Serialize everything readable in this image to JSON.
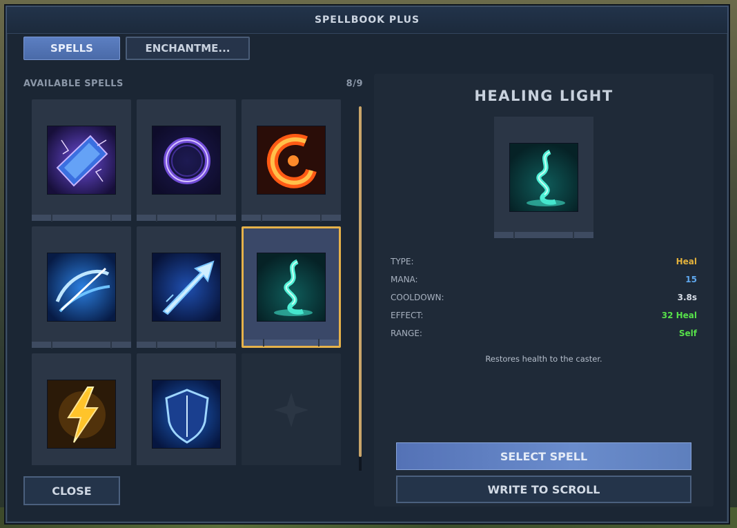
{
  "window": {
    "title": "SPELLBOOK PLUS"
  },
  "tabs": [
    {
      "label": "SPELLS",
      "active": true
    },
    {
      "label": "ENCHANTME...",
      "active": false
    }
  ],
  "spell_list": {
    "header": "AVAILABLE SPELLS",
    "count": "8/9",
    "scroll_fraction_visible": 0.96,
    "spells": [
      {
        "icon": "arcane-crystal-icon"
      },
      {
        "icon": "arcane-ring-icon"
      },
      {
        "icon": "fire-swirl-icon"
      },
      {
        "icon": "frost-slash-icon"
      },
      {
        "icon": "ice-arrow-icon"
      },
      {
        "icon": "healing-light-icon",
        "selected": true
      },
      {
        "icon": "lightning-bolt-icon"
      },
      {
        "icon": "frost-shield-icon"
      },
      {
        "icon": "empty-slot-icon",
        "empty": true
      }
    ]
  },
  "close_label": "CLOSE",
  "detail": {
    "name": "HEALING LIGHT",
    "icon": "healing-light-icon",
    "stats": [
      {
        "label": "TYPE:",
        "value": "Heal",
        "color": "#e3b23c"
      },
      {
        "label": "MANA:",
        "value": "15",
        "color": "#5fa8ee"
      },
      {
        "label": "COOLDOWN:",
        "value": "3.8s",
        "color": "#d7dde6"
      },
      {
        "label": "EFFECT:",
        "value": "32 Heal",
        "color": "#57e04a"
      },
      {
        "label": "RANGE:",
        "value": "Self",
        "color": "#57e04a"
      }
    ],
    "description": "Restores health to the caster.",
    "select_label": "SELECT SPELL",
    "scroll_label": "WRITE TO SCROLL"
  },
  "colors": {
    "accent_selected": "#e6b24a",
    "primary_button": "#5c7fc2"
  }
}
